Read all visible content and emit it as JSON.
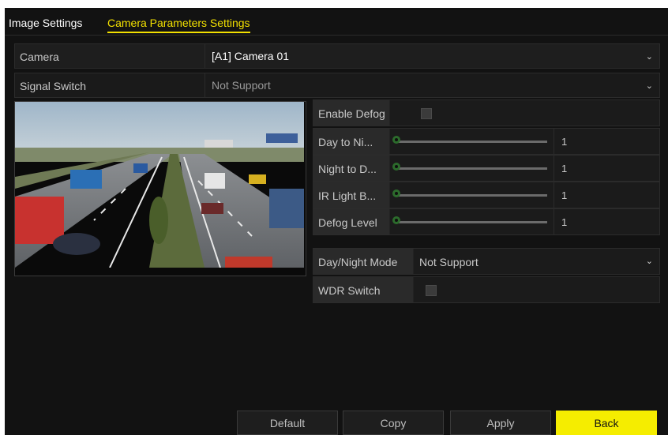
{
  "tabs": [
    {
      "label": "Image Settings",
      "active": false
    },
    {
      "label": "Camera Parameters Settings",
      "active": true
    }
  ],
  "camera": {
    "label": "Camera",
    "value": "[A1] Camera 01"
  },
  "signal_switch": {
    "label": "Signal Switch",
    "value": "Not Support"
  },
  "params": {
    "enable_defog": {
      "label": "Enable Defog",
      "checked": false
    },
    "sliders": [
      {
        "label": "Day to Ni...",
        "value": "1"
      },
      {
        "label": "Night to D...",
        "value": "1"
      },
      {
        "label": "IR Light B...",
        "value": "1"
      },
      {
        "label": "Defog Level",
        "value": "1"
      }
    ],
    "day_night_mode": {
      "label": "Day/Night Mode",
      "value": "Not Support"
    },
    "wdr_switch": {
      "label": "WDR Switch",
      "checked": false
    }
  },
  "buttons": {
    "default": "Default",
    "copy": "Copy",
    "apply": "Apply",
    "back": "Back"
  },
  "colors": {
    "accent": "#f2e000",
    "background": "#121212",
    "slider_knob": "#2c6b2c"
  },
  "icons": {
    "dropdown": "chevron-down-icon"
  }
}
